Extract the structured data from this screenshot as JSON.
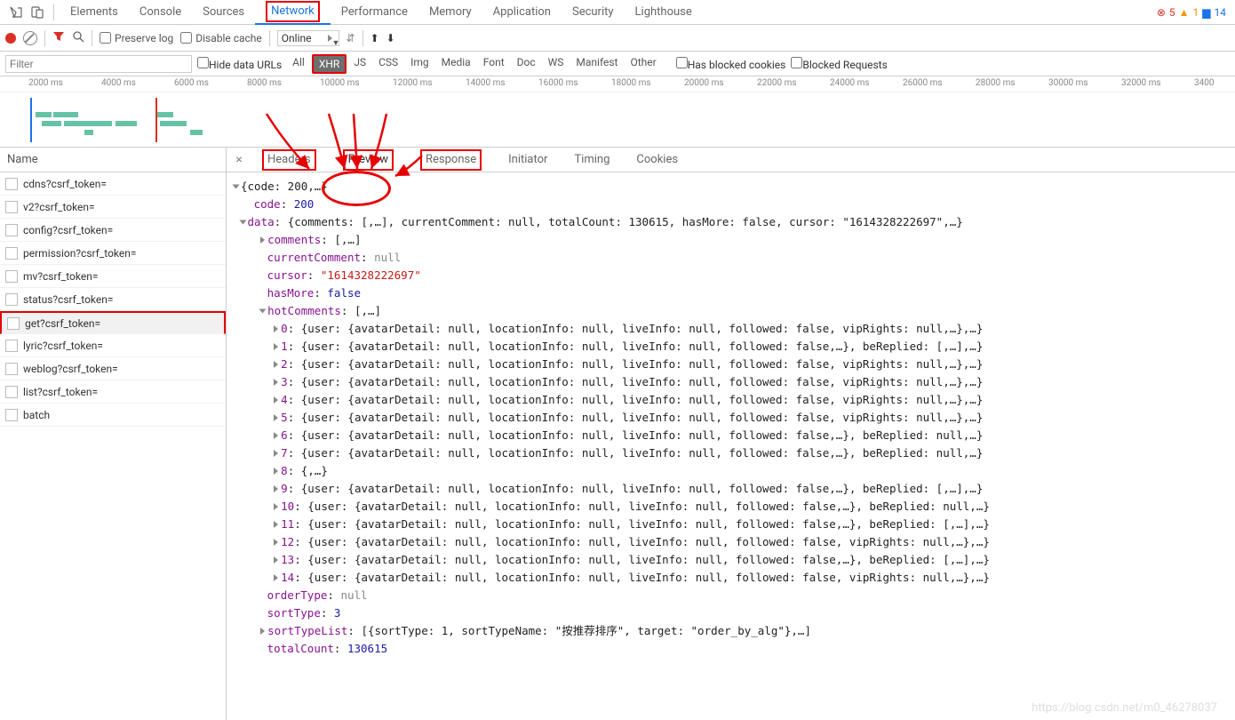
{
  "topTabs": [
    "Elements",
    "Console",
    "Sources",
    "Network",
    "Performance",
    "Memory",
    "Application",
    "Security",
    "Lighthouse"
  ],
  "activeTopTab": "Network",
  "status": {
    "err": 5,
    "warn": 1,
    "msg": 14
  },
  "toolbar": {
    "preserveLog": "Preserve log",
    "disableCache": "Disable cache",
    "throttling": "Online"
  },
  "filterRow": {
    "placeholder": "Filter",
    "hideDataUrls": "Hide data URLs",
    "chips": [
      "All",
      "XHR",
      "JS",
      "CSS",
      "Img",
      "Media",
      "Font",
      "Doc",
      "WS",
      "Manifest",
      "Other"
    ],
    "activeChip": "XHR",
    "hasBlockedCookies": "Has blocked cookies",
    "blockedRequests": "Blocked Requests"
  },
  "ruler": [
    "2000 ms",
    "4000 ms",
    "6000 ms",
    "8000 ms",
    "10000 ms",
    "12000 ms",
    "14000 ms",
    "16000 ms",
    "18000 ms",
    "20000 ms",
    "22000 ms",
    "24000 ms",
    "26000 ms",
    "28000 ms",
    "30000 ms",
    "32000 ms",
    "3400"
  ],
  "leftHeader": "Name",
  "requests": [
    "cdns?csrf_token=",
    "v2?csrf_token=",
    "config?csrf_token=",
    "permission?csrf_token=",
    "mv?csrf_token=",
    "status?csrf_token=",
    "get?csrf_token=",
    "lyric?csrf_token=",
    "weblog?csrf_token=",
    "list?csrf_token=",
    "batch"
  ],
  "selectedRequest": 6,
  "innerTabs": [
    "Headers",
    "Preview",
    "Response",
    "Initiator",
    "Timing",
    "Cookies"
  ],
  "activeInnerTab": "Preview",
  "preview": {
    "topLine": "{code: 200,…}",
    "code": 200,
    "dataLine": "{comments: [,…], currentComment: null, totalCount: 130615, hasMore: false, cursor: \"1614328222697\",…}",
    "commentsVal": "[,…]",
    "currentComment": "null",
    "cursor": "\"1614328222697\"",
    "hasMore": "false",
    "hotCommentsVal": "[,…]",
    "hotItems": [
      {
        "i": "0",
        "body": "{user: {avatarDetail: null, locationInfo: null, liveInfo: null, followed: false, vipRights: null,…},…}"
      },
      {
        "i": "1",
        "body": "{user: {avatarDetail: null, locationInfo: null, liveInfo: null, followed: false,…}, beReplied: [,…],…}"
      },
      {
        "i": "2",
        "body": "{user: {avatarDetail: null, locationInfo: null, liveInfo: null, followed: false, vipRights: null,…},…}"
      },
      {
        "i": "3",
        "body": "{user: {avatarDetail: null, locationInfo: null, liveInfo: null, followed: false, vipRights: null,…},…}"
      },
      {
        "i": "4",
        "body": "{user: {avatarDetail: null, locationInfo: null, liveInfo: null, followed: false, vipRights: null,…},…}"
      },
      {
        "i": "5",
        "body": "{user: {avatarDetail: null, locationInfo: null, liveInfo: null, followed: false, vipRights: null,…},…}"
      },
      {
        "i": "6",
        "body": "{user: {avatarDetail: null, locationInfo: null, liveInfo: null, followed: false,…}, beReplied: null,…}"
      },
      {
        "i": "7",
        "body": "{user: {avatarDetail: null, locationInfo: null, liveInfo: null, followed: false,…}, beReplied: null,…}"
      },
      {
        "i": "8",
        "body": "{,…}"
      },
      {
        "i": "9",
        "body": "{user: {avatarDetail: null, locationInfo: null, liveInfo: null, followed: false,…}, beReplied: [,…],…}"
      },
      {
        "i": "10",
        "body": "{user: {avatarDetail: null, locationInfo: null, liveInfo: null, followed: false,…}, beReplied: null,…}"
      },
      {
        "i": "11",
        "body": "{user: {avatarDetail: null, locationInfo: null, liveInfo: null, followed: false,…}, beReplied: [,…],…}"
      },
      {
        "i": "12",
        "body": "{user: {avatarDetail: null, locationInfo: null, liveInfo: null, followed: false, vipRights: null,…},…}"
      },
      {
        "i": "13",
        "body": "{user: {avatarDetail: null, locationInfo: null, liveInfo: null, followed: false,…}, beReplied: [,…],…}"
      },
      {
        "i": "14",
        "body": "{user: {avatarDetail: null, locationInfo: null, liveInfo: null, followed: false, vipRights: null,…},…}"
      }
    ],
    "orderType": "null",
    "sortType": 3,
    "sortTypeListVal": "[{sortType: 1, sortTypeName: \"按推荐排序\", target: \"order_by_alg\"},…]",
    "totalCount": 130615
  },
  "watermark": "https://blog.csdn.net/m0_46278037"
}
